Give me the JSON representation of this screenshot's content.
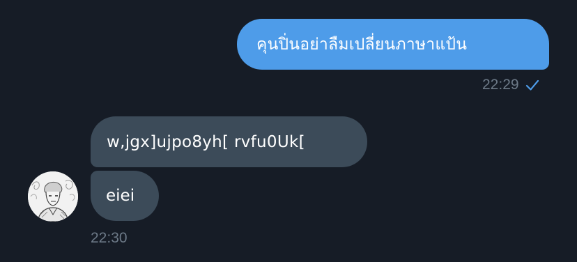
{
  "chat": {
    "outgoing_message": {
      "text": "คุนปิ่นอย่าลืมเปลี่ยนภาษาแป้น",
      "time": "22:29",
      "status_icon": "single-check-icon"
    },
    "incoming_messages": [
      {
        "text": "w,jgx]ujpo8yh[ rvfu0Uk["
      },
      {
        "text": "eiei"
      }
    ],
    "incoming_time": "22:30",
    "avatar_icon": "sketch-portrait-avatar"
  },
  "colors": {
    "background": "#161c26",
    "outgoing_bubble": "#4e9ce9",
    "incoming_bubble": "#3c4b59",
    "timestamp": "#6d7a88",
    "check": "#4e9ce9"
  }
}
